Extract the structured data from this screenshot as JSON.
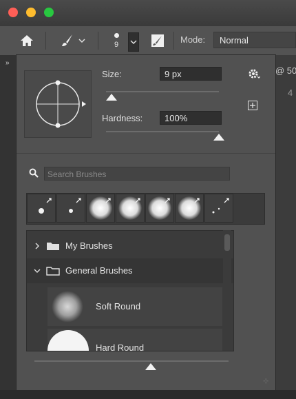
{
  "window": {
    "traffic_colors": [
      "#ff5f57",
      "#febc2e",
      "#28c840"
    ]
  },
  "options_bar": {
    "home_icon": "home-icon",
    "brush_icon": "brush-icon",
    "brush_size_value": "9",
    "toggle_icon": "brush-panel-toggle-icon",
    "mode_label": "Mode:",
    "mode_value": "Normal",
    "doc_tab_partial": "@ 50",
    "ruler_partial": "4"
  },
  "brush_panel": {
    "size_label": "Size:",
    "size_value": "9 px",
    "size_slider_fraction": 0.05,
    "hardness_label": "Hardness:",
    "hardness_value": "100%",
    "hardness_slider_fraction": 1.0,
    "gear_icon": "gear-icon",
    "new_preset_icon": "new-preset-icon",
    "search_placeholder": "Search Brushes",
    "recent_tips": [
      {
        "kind": "hard",
        "name": "hard-small"
      },
      {
        "kind": "hard",
        "name": "hard-smaller"
      },
      {
        "kind": "soft",
        "name": "soft-large"
      },
      {
        "kind": "soft",
        "name": "soft-large-2"
      },
      {
        "kind": "soft",
        "name": "soft-large-3"
      },
      {
        "kind": "soft",
        "name": "soft-large-4"
      },
      {
        "kind": "dots",
        "name": "scatter"
      }
    ],
    "folders": [
      {
        "label": "My Brushes",
        "expanded": false
      },
      {
        "label": "General Brushes",
        "expanded": true
      }
    ],
    "brushes": [
      {
        "label": "Soft Round"
      },
      {
        "label": "Hard Round"
      }
    ],
    "preview_size_fraction": 0.6
  },
  "colors": {
    "panel_bg": "#515151",
    "dark_field": "#2f2f2f",
    "accent_white": "#f2f2f2"
  }
}
